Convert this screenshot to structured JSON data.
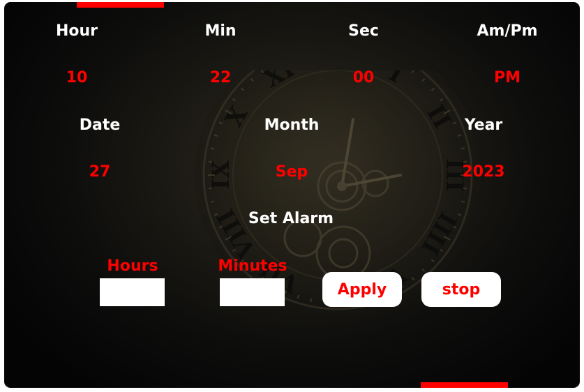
{
  "clock": {
    "labels": {
      "hour": "Hour",
      "min": "Min",
      "sec": "Sec",
      "ampm": "Am/Pm"
    },
    "values": {
      "hour": "10",
      "min": "22",
      "sec": "00",
      "ampm": "PM"
    }
  },
  "calendar": {
    "labels": {
      "date": "Date",
      "month": "Month",
      "year": "Year"
    },
    "values": {
      "date": "27",
      "month": "Sep",
      "year": "2023"
    }
  },
  "alarm": {
    "title": "Set Alarm",
    "hours_label": "Hours",
    "minutes_label": "Minutes",
    "hours_value": "",
    "minutes_value": "",
    "apply_label": "Apply",
    "stop_label": "stop"
  },
  "colors": {
    "accent": "#ff0000",
    "text_primary": "#ffffff",
    "background": "#0b0b0b",
    "button_bg": "#ffffff"
  },
  "icons": {
    "background_art": "vintage-clock-face"
  }
}
